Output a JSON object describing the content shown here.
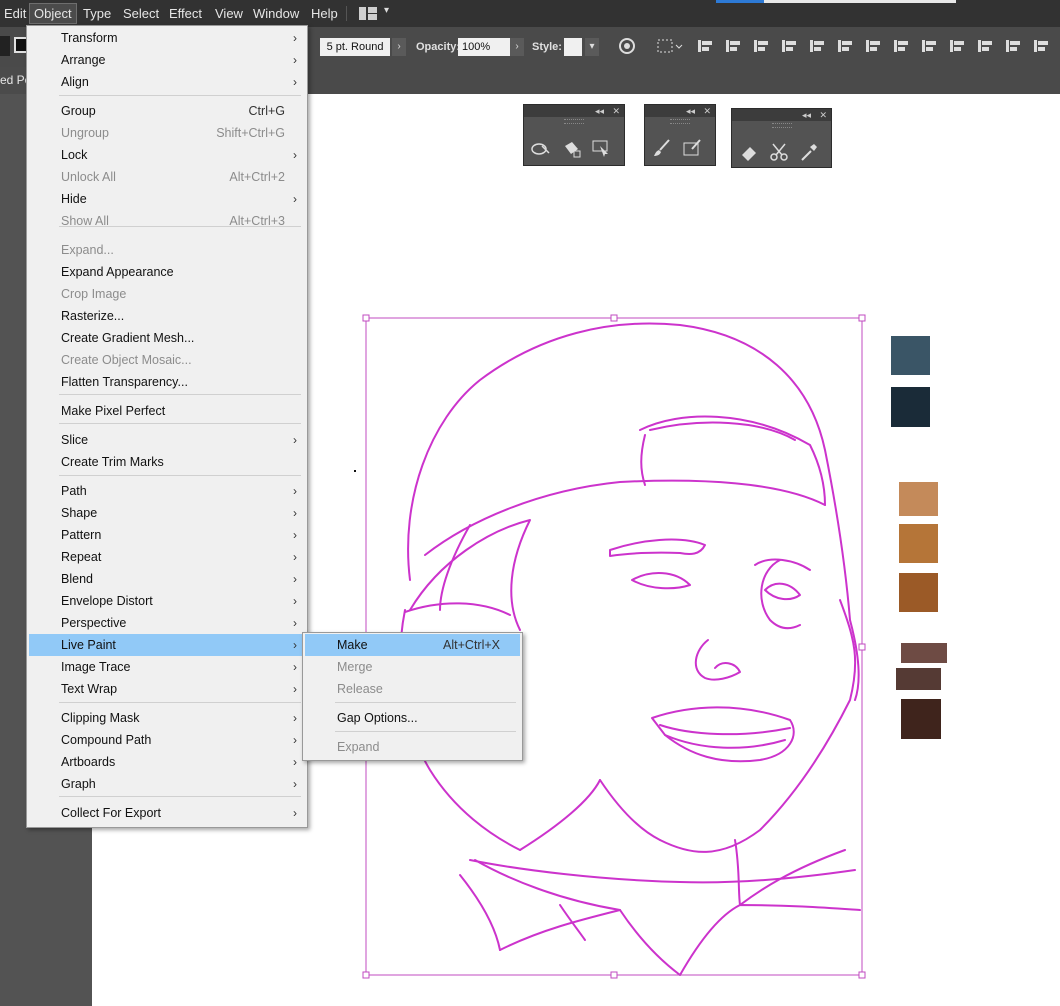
{
  "menubar": {
    "items": [
      "Edit",
      "Object",
      "Type",
      "Select",
      "Effect",
      "View",
      "Window",
      "Help"
    ]
  },
  "controlbar": {
    "stroke_profile": "5 pt. Round",
    "opacity_label": "Opacity:",
    "opacity_value": "100%",
    "style_label": "Style:"
  },
  "document_tab": {
    "label": "ed Po"
  },
  "object_menu": {
    "items": [
      {
        "label": "Transform",
        "submenu": true
      },
      {
        "label": "Arrange",
        "submenu": true
      },
      {
        "label": "Align",
        "submenu": true
      },
      {
        "label": "Group",
        "shortcut": "Ctrl+G"
      },
      {
        "label": "Ungroup",
        "shortcut": "Shift+Ctrl+G",
        "disabled": true
      },
      {
        "label": "Lock",
        "submenu": true
      },
      {
        "label": "Unlock All",
        "shortcut": "Alt+Ctrl+2",
        "disabled": true
      },
      {
        "label": "Hide",
        "submenu": true
      },
      {
        "label": "Show All",
        "shortcut": "Alt+Ctrl+3",
        "disabled": true
      },
      {
        "label": "Expand...",
        "disabled": true
      },
      {
        "label": "Expand Appearance"
      },
      {
        "label": "Crop Image",
        "disabled": true
      },
      {
        "label": "Rasterize..."
      },
      {
        "label": "Create Gradient Mesh..."
      },
      {
        "label": "Create Object Mosaic...",
        "disabled": true
      },
      {
        "label": "Flatten Transparency..."
      },
      {
        "label": "Make Pixel Perfect"
      },
      {
        "label": "Slice",
        "submenu": true
      },
      {
        "label": "Create Trim Marks"
      },
      {
        "label": "Path",
        "submenu": true
      },
      {
        "label": "Shape",
        "submenu": true
      },
      {
        "label": "Pattern",
        "submenu": true
      },
      {
        "label": "Repeat",
        "submenu": true
      },
      {
        "label": "Blend",
        "submenu": true
      },
      {
        "label": "Envelope Distort",
        "submenu": true
      },
      {
        "label": "Perspective",
        "submenu": true
      },
      {
        "label": "Live Paint",
        "submenu": true,
        "highlighted": true
      },
      {
        "label": "Image Trace",
        "submenu": true
      },
      {
        "label": "Text Wrap",
        "submenu": true
      },
      {
        "label": "Clipping Mask",
        "submenu": true
      },
      {
        "label": "Compound Path",
        "submenu": true
      },
      {
        "label": "Artboards",
        "submenu": true
      },
      {
        "label": "Graph",
        "submenu": true
      },
      {
        "label": "Collect For Export",
        "submenu": true
      }
    ]
  },
  "live_paint_submenu": {
    "items": [
      {
        "label": "Make",
        "shortcut": "Alt+Ctrl+X",
        "highlighted": true
      },
      {
        "label": "Merge",
        "disabled": true
      },
      {
        "label": "Release",
        "disabled": true
      },
      {
        "label": "Gap Options..."
      },
      {
        "label": "Expand",
        "disabled": true
      }
    ]
  },
  "swatches": {
    "colors": [
      "#3a5566",
      "#1a2b38",
      "#c48a5a",
      "#b57538",
      "#9b5a27",
      "#6e4b44",
      "#553a34",
      "#3f241c"
    ]
  },
  "colors": {
    "path_stroke": "#cc33cc",
    "selection_box": "#c04bc0",
    "menu_highlight": "#91c9f7"
  }
}
